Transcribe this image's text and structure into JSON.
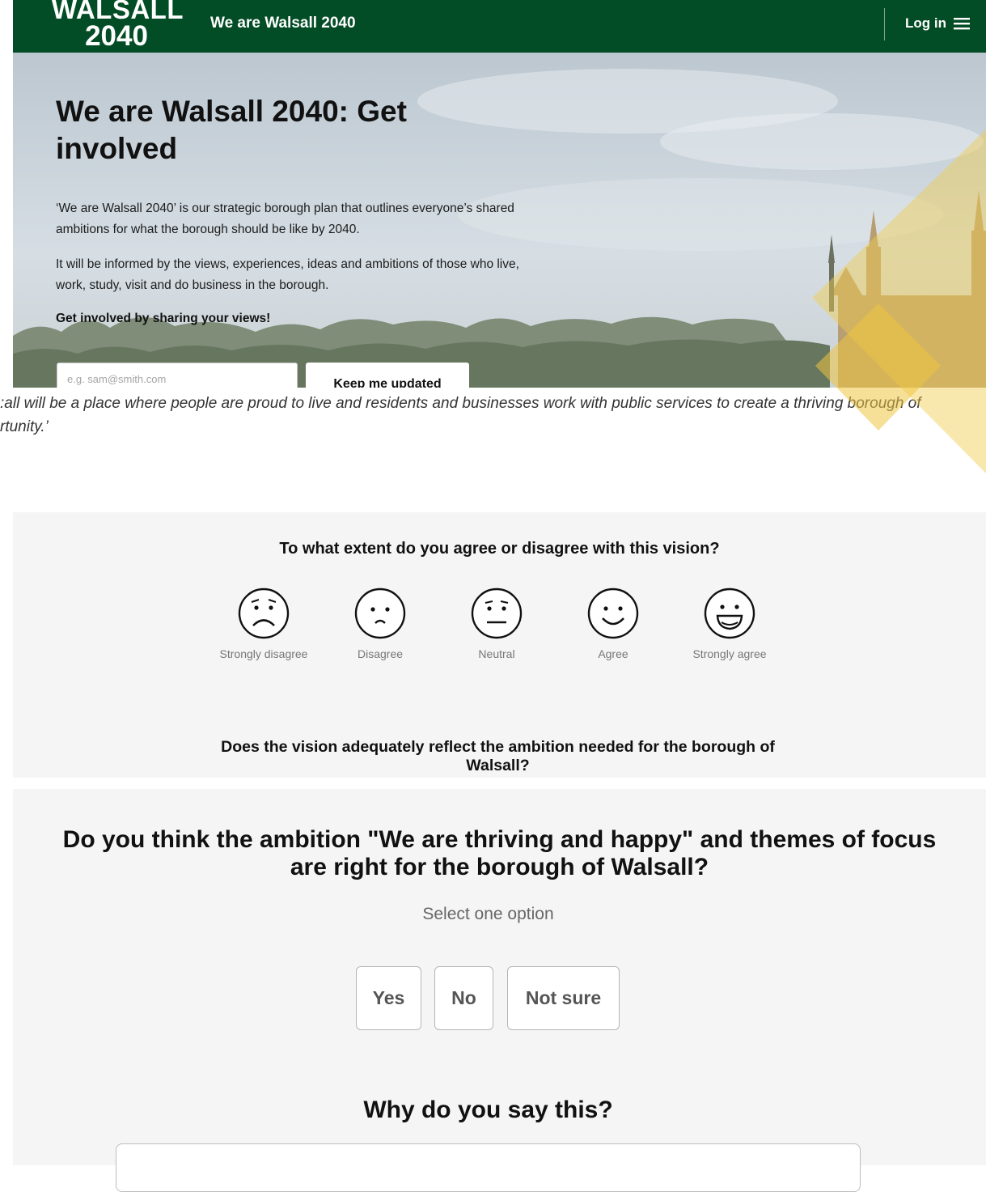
{
  "header": {
    "logo_line1": "WALSALL",
    "logo_line2": "2040",
    "site_title": "We are Walsall 2040",
    "login_label": "Log in",
    "menu_icon": "menu-icon"
  },
  "hero": {
    "title": "We are Walsall 2040: Get involved",
    "paragraph1": "‘We are Walsall 2040’ is our strategic borough plan that outlines everyone’s shared ambitions for what the borough should be like by 2040.",
    "paragraph2": "It will be informed by the views, experiences, ideas and ambitions of those who live, work, study, visit and do business in the borough.",
    "cta": "Get involved by sharing your views!",
    "email_placeholder": "e.g. sam@smith.com",
    "button_label": "Keep me updated"
  },
  "vision_quote": ":all will be a place where people are proud to live and residents and businesses work with public services to create a thriving borough of rtunity.’",
  "question1": {
    "title": "To what extent do you agree or disagree with this vision?",
    "options": [
      {
        "label": "Strongly disagree",
        "icon": "very-sad-face-icon"
      },
      {
        "label": "Disagree",
        "icon": "sad-face-icon"
      },
      {
        "label": "Neutral",
        "icon": "neutral-face-icon"
      },
      {
        "label": "Agree",
        "icon": "smile-face-icon"
      },
      {
        "label": "Strongly agree",
        "icon": "big-smile-face-icon"
      }
    ]
  },
  "question2": {
    "title": "Does the vision adequately reflect the ambition needed for the borough of Walsall?"
  },
  "question3": {
    "title": "Do you think the ambition \"We are thriving and happy\" and themes of focus are right for the borough of Walsall?",
    "hint": "Select one option",
    "options": [
      "Yes",
      "No",
      "Not sure"
    ],
    "follow_up": "Why do you say this?"
  },
  "colors": {
    "header_green": "#034d26",
    "accent_yellow": "#f2cc4c",
    "survey_bg": "#f5f5f5"
  }
}
